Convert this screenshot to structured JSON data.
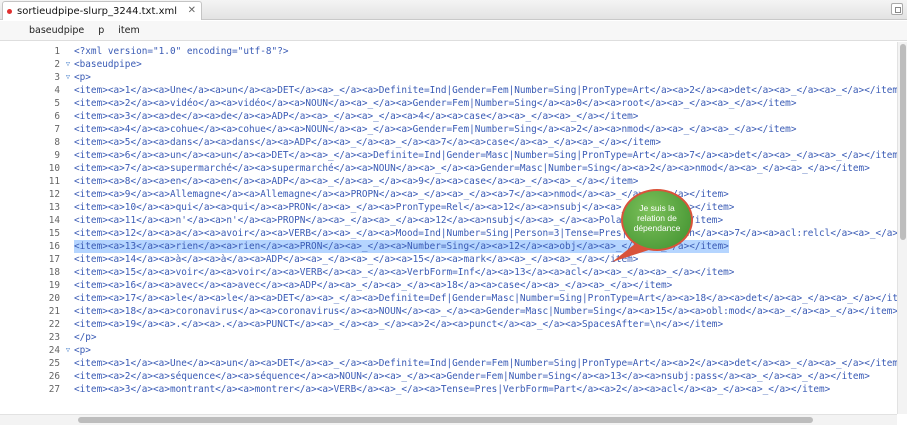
{
  "tab": {
    "title": "sortieudpipe-slurp_3244.txt.xml",
    "close_glyph": "✕"
  },
  "breadcrumb": [
    "baseudpipe",
    "p",
    "item"
  ],
  "selected_line": 16,
  "editor": {
    "lines": [
      {
        "n": "1",
        "fold": "",
        "text": "<?xml version=\"1.0\" encoding=\"utf-8\"?>"
      },
      {
        "n": "2",
        "fold": "▽",
        "text": "<baseudpipe>"
      },
      {
        "n": "3",
        "fold": "▽",
        "text": "<p>"
      },
      {
        "n": "4",
        "fold": "",
        "text": "<item><a>1</a><a>Une</a><a>un</a><a>DET</a><a>_</a><a>Definite=Ind|Gender=Fem|Number=Sing|PronType=Art</a><a>2</a><a>det</a><a>_</a><a>_</a></item>"
      },
      {
        "n": "5",
        "fold": "",
        "text": "<item><a>2</a><a>vidéo</a><a>vidéo</a><a>NOUN</a><a>_</a><a>Gender=Fem|Number=Sing</a><a>0</a><a>root</a><a>_</a><a>_</a></item>"
      },
      {
        "n": "6",
        "fold": "",
        "text": "<item><a>3</a><a>de</a><a>de</a><a>ADP</a><a>_</a><a>_</a><a>4</a><a>case</a><a>_</a><a>_</a></item>"
      },
      {
        "n": "7",
        "fold": "",
        "text": "<item><a>4</a><a>cohue</a><a>cohue</a><a>NOUN</a><a>_</a><a>Gender=Fem|Number=Sing</a><a>2</a><a>nmod</a><a>_</a><a>_</a></item>"
      },
      {
        "n": "8",
        "fold": "",
        "text": "<item><a>5</a><a>dans</a><a>dans</a><a>ADP</a><a>_</a><a>_</a><a>7</a><a>case</a><a>_</a><a>_</a></item>"
      },
      {
        "n": "9",
        "fold": "",
        "text": "<item><a>6</a><a>un</a><a>un</a><a>DET</a><a>_</a><a>Definite=Ind|Gender=Masc|Number=Sing|PronType=Art</a><a>7</a><a>det</a><a>_</a><a>_</a></item>"
      },
      {
        "n": "10",
        "fold": "",
        "text": "<item><a>7</a><a>supermarché</a><a>supermarché</a><a>NOUN</a><a>_</a><a>Gender=Masc|Number=Sing</a><a>2</a><a>nmod</a><a>_</a><a>_</a></item>"
      },
      {
        "n": "11",
        "fold": "",
        "text": "<item><a>8</a><a>en</a><a>en</a><a>ADP</a><a>_</a><a>_</a><a>9</a><a>case</a><a>_</a><a>_</a></item>"
      },
      {
        "n": "12",
        "fold": "",
        "text": "<item><a>9</a><a>Allemagne</a><a>Allemagne</a><a>PROPN</a><a>_</a><a>_</a><a>7</a><a>nmod</a><a>_</a><a>_</a></item>"
      },
      {
        "n": "13",
        "fold": "",
        "text": "<item><a>10</a><a>qui</a><a>qui</a><a>PRON</a><a>_</a><a>PronType=Rel</a><a>12</a><a>nsubj</a><a>_</a><a>_</a></item>"
      },
      {
        "n": "14",
        "fold": "",
        "text": "<item><a>11</a><a>n'</a><a>n'</a><a>PROPN</a><a>_</a><a>_</a><a>12</a><a>nsubj</a><a>_</a><a>Polarity=No</a></item>"
      },
      {
        "n": "15",
        "fold": "",
        "text": "<item><a>12</a><a>a</a><a>avoir</a><a>VERB</a><a>_</a><a>Mood=Ind|Number=Sing|Person=3|Tense=Pres|VerbForm=Fin</a><a>7</a><a>acl:relcl</a><a>_</a><a>_</a></item>"
      },
      {
        "n": "16",
        "fold": "",
        "text": "<item><a>13</a><a>rien</a><a>rien</a><a>PRON</a><a>_</a><a>Number=Sing</a><a>12</a><a>obj</a><a>_</a><a>_</a></item>"
      },
      {
        "n": "17",
        "fold": "",
        "text": "<item><a>14</a><a>à</a><a>à</a><a>ADP</a><a>_</a><a>_</a><a>15</a><a>mark</a><a>_</a><a>_</a></item>"
      },
      {
        "n": "18",
        "fold": "",
        "text": "<item><a>15</a><a>voir</a><a>voir</a><a>VERB</a><a>_</a><a>VerbForm=Inf</a><a>13</a><a>acl</a><a>_</a><a>_</a></item>"
      },
      {
        "n": "19",
        "fold": "",
        "text": "<item><a>16</a><a>avec</a><a>avec</a><a>ADP</a><a>_</a><a>_</a><a>18</a><a>case</a><a>_</a><a>_</a></item>"
      },
      {
        "n": "20",
        "fold": "",
        "text": "<item><a>17</a><a>le</a><a>le</a><a>DET</a><a>_</a><a>Definite=Def|Gender=Masc|Number=Sing|PronType=Art</a><a>18</a><a>det</a><a>_</a><a>_</a></item>"
      },
      {
        "n": "21",
        "fold": "",
        "text": "<item><a>18</a><a>coronavirus</a><a>coronavirus</a><a>NOUN</a><a>_</a><a>Gender=Masc|Number=Sing</a><a>15</a><a>obl:mod</a><a>_</a><a>_</a></item>"
      },
      {
        "n": "22",
        "fold": "",
        "text": "<item><a>19</a><a>.</a><a>.</a><a>PUNCT</a><a>_</a><a>_</a><a>2</a><a>punct</a><a>_</a><a>SpacesAfter=\\n</a></item>"
      },
      {
        "n": "23",
        "fold": "",
        "text": "</p>"
      },
      {
        "n": "24",
        "fold": "▽",
        "text": "<p>"
      },
      {
        "n": "25",
        "fold": "",
        "text": "<item><a>1</a><a>Une</a><a>un</a><a>DET</a><a>_</a><a>Definite=Ind|Gender=Fem|Number=Sing|PronType=Art</a><a>2</a><a>det</a><a>_</a><a>_</a></item>"
      },
      {
        "n": "26",
        "fold": "",
        "text": "<item><a>2</a><a>séquence</a><a>séquence</a><a>NOUN</a><a>_</a><a>Gender=Fem|Number=Sing</a><a>13</a><a>nsubj:pass</a><a>_</a><a>_</a></item>"
      },
      {
        "n": "27",
        "fold": "",
        "text": "<item><a>3</a><a>montrant</a><a>montrer</a><a>VERB</a><a>_</a><a>Tense=Pres|VerbForm=Part</a><a>2</a><a>acl</a><a>_</a><a>_</a></item>"
      }
    ]
  },
  "callout": {
    "line1": "Je suis la",
    "line2": "relation de",
    "line3": "dépendance"
  },
  "colors": {
    "code": "#3a5bb5",
    "selection": "#b5d5ff",
    "callout_fill": "#4f9f3a",
    "callout_border": "#d9533a"
  }
}
